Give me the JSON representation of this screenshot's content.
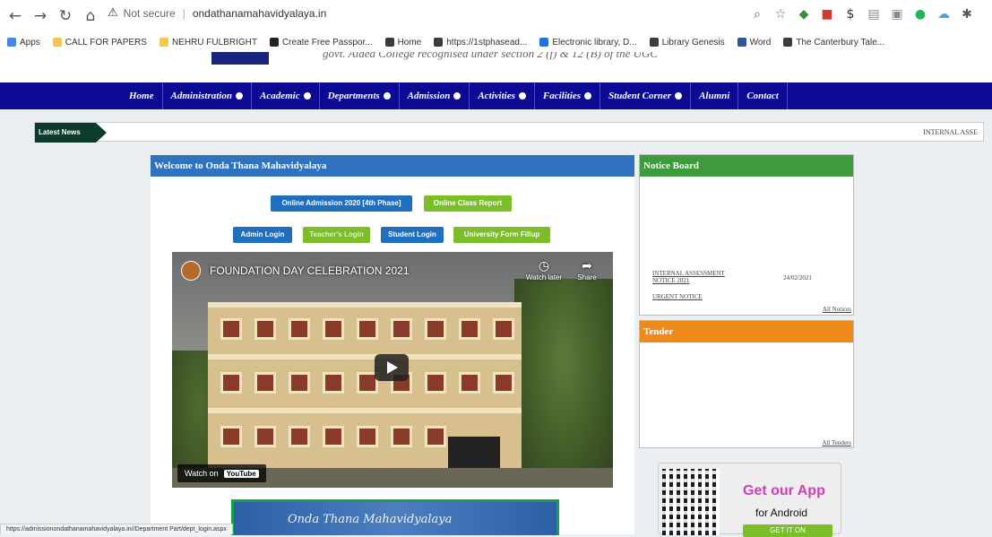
{
  "browser": {
    "security": "Not secure",
    "url": "ondathanamahavidyalaya.in",
    "bookmarks": [
      "Apps",
      "CALL FOR PAPERS",
      "NEHRU FULBRIGHT",
      "Create Free Passpor...",
      "Home",
      "https://1stphasead...",
      "Electronic library, D...",
      "Library Genesis",
      "Word",
      "The Canterbury Tale..."
    ],
    "bookmark_colors": [
      "#4285f4",
      "#f6c744",
      "#f6c744",
      "#222222",
      "#3c3c3c",
      "#3c3c3c",
      "#1a73e8",
      "#3c3c3c",
      "#2b579a",
      "#3c3c3c"
    ],
    "status_url": "https://admissionondathanamahavidyalaya.in//Department Part/dept_login.aspx"
  },
  "header": {
    "logo_strip": "",
    "cut_text": "govt. Aided College recognised under section 2 (f) & 12 (B) of the UGC"
  },
  "nav": [
    {
      "label": "Home",
      "dropdown": false
    },
    {
      "label": "Administration",
      "dropdown": true
    },
    {
      "label": "Academic",
      "dropdown": true
    },
    {
      "label": "Departments",
      "dropdown": true
    },
    {
      "label": "Admission",
      "dropdown": true
    },
    {
      "label": "Activities",
      "dropdown": true
    },
    {
      "label": "Facilities",
      "dropdown": true
    },
    {
      "label": "Student Corner",
      "dropdown": true
    },
    {
      "label": "Alumni",
      "dropdown": false
    },
    {
      "label": "Contact",
      "dropdown": false
    }
  ],
  "news": {
    "tag": "Latest News",
    "ticker": "INTERNAL ASSE"
  },
  "welcome": {
    "title": "Welcome to Onda Thana Mahavidyalaya",
    "buttons_row1": [
      "Online Admission 2020 [4th Phase]",
      "Online Class Report"
    ],
    "buttons_row2": [
      "Admin Login",
      "Teacher's Login",
      "Student Login",
      "University Form Fillup"
    ],
    "video_title": "FOUNDATION DAY CELEBRATION 2021",
    "watch_later": "Watch later",
    "share": "Share",
    "watch_on": "Watch on",
    "youtube": "YouTube",
    "banner": "Onda Thana Mahavidyalaya"
  },
  "notice_board": {
    "title": "Notice Board",
    "item_line1": "INTERNAL ASSESSMENT",
    "item_line2": "NOTICE 2021",
    "item_date": "24/02/2021",
    "item2": "URGENT NOTICE",
    "all_link": "All Notices"
  },
  "tender": {
    "title": "Tender",
    "all_link": "All Tenders"
  },
  "app": {
    "line1": "Get our App",
    "line2": "for Android",
    "button": "GET IT ON"
  }
}
